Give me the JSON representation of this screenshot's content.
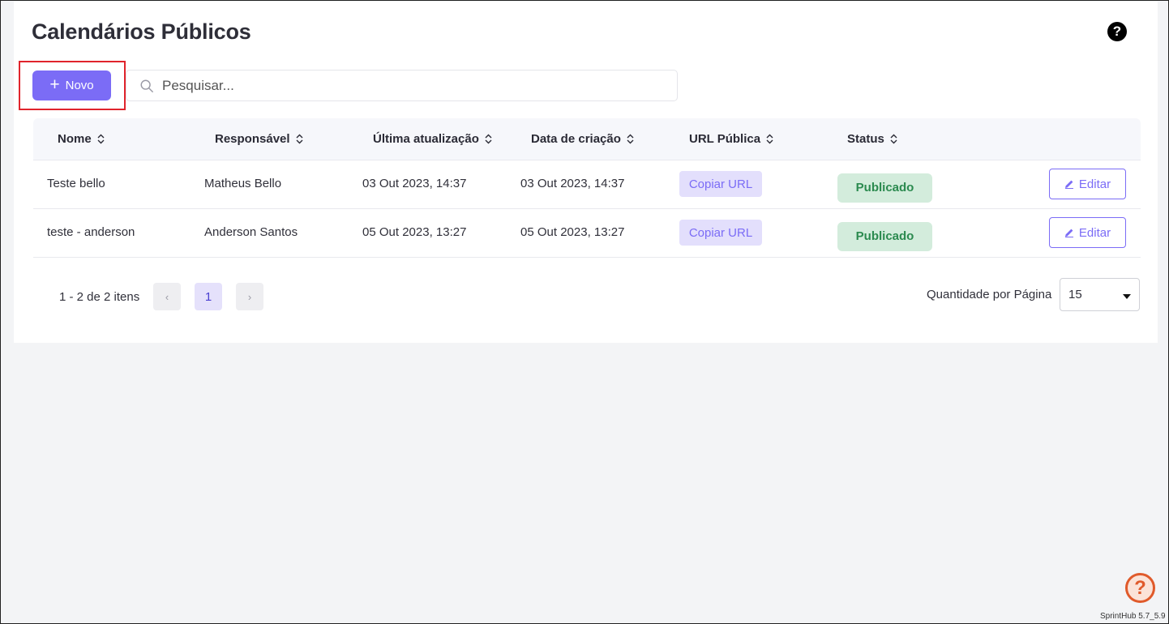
{
  "page": {
    "title": "Calendários Públicos",
    "help_icon": "question-circle-icon"
  },
  "toolbar": {
    "new_button_label": "Novo",
    "new_button_icon": "plus-icon",
    "search_placeholder": "Pesquisar...",
    "search_icon": "search-icon"
  },
  "table": {
    "columns": [
      "Nome",
      "Responsável",
      "Última atualização",
      "Data de criação",
      "URL Pública",
      "Status"
    ],
    "rows": [
      {
        "nome": "Teste bello",
        "responsavel": "Matheus Bello",
        "atualizacao": "03 Out 2023, 14:37",
        "criacao": "03 Out 2023, 14:37",
        "url_button": "Copiar URL",
        "status": "Publicado",
        "edit_label": "Editar"
      },
      {
        "nome": "teste - anderson",
        "responsavel": "Anderson Santos",
        "atualizacao": "05 Out 2023, 13:27",
        "criacao": "05 Out 2023, 13:27",
        "url_button": "Copiar URL",
        "status": "Publicado",
        "edit_label": "Editar"
      }
    ]
  },
  "pagination": {
    "info": "1 - 2 de 2 itens",
    "prev": "‹",
    "current_page": "1",
    "next": "›",
    "page_size_label": "Quantidade por Página",
    "page_size_value": "15"
  },
  "footer": {
    "help_fab": "?",
    "version": "SprintHub 5.7_5.9"
  },
  "colors": {
    "accent": "#7b6cf6",
    "status_green_bg": "#d3ecdc",
    "status_green_text": "#2b8a4f",
    "highlight": "#e0242c"
  }
}
